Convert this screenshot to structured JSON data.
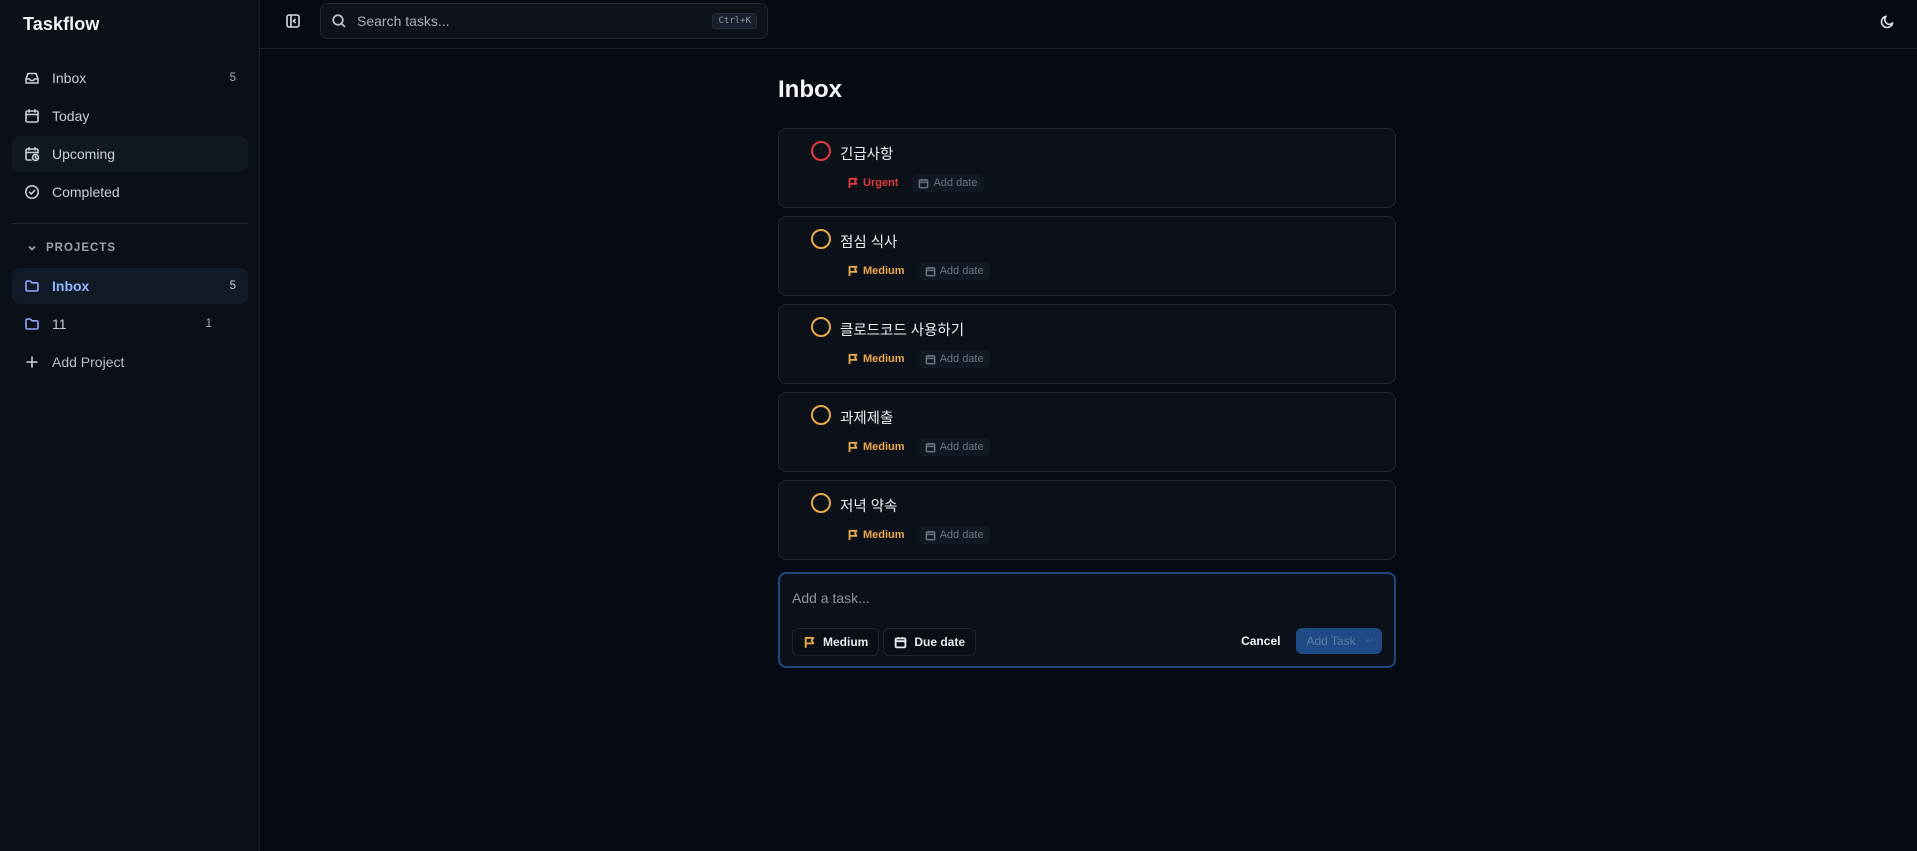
{
  "app": {
    "brand": "Taskflow"
  },
  "sidebar": {
    "nav": [
      {
        "label": "Inbox",
        "count": "5",
        "icon": "inbox-icon"
      },
      {
        "label": "Today",
        "count": "",
        "icon": "calendar-icon"
      },
      {
        "label": "Upcoming",
        "count": "",
        "icon": "calendar-clock-icon"
      },
      {
        "label": "Completed",
        "count": "",
        "icon": "check-circle-icon"
      }
    ],
    "projects_heading": "PROJECTS",
    "projects": [
      {
        "label": "Inbox",
        "count": "5",
        "active": true
      },
      {
        "label": "11",
        "count": "1",
        "active": false
      }
    ],
    "add_project": "Add Project"
  },
  "topbar": {
    "search_placeholder": "Search tasks...",
    "shortcut": "Ctrl+K"
  },
  "main": {
    "title": "Inbox",
    "tasks": [
      {
        "title": "긴급사항",
        "priority": "Urgent",
        "date": "Add date",
        "priority_color": "#e23b3b"
      },
      {
        "title": "점심 식사",
        "priority": "Medium",
        "date": "Add date",
        "priority_color": "#e8a94a"
      },
      {
        "title": "클로드코드 사용하기",
        "priority": "Medium",
        "date": "Add date",
        "priority_color": "#e8a94a"
      },
      {
        "title": "과제제출",
        "priority": "Medium",
        "date": "Add date",
        "priority_color": "#e8a94a"
      },
      {
        "title": "저녁 약속",
        "priority": "Medium",
        "date": "Add date",
        "priority_color": "#e8a94a"
      }
    ],
    "composer": {
      "placeholder": "Add a task...",
      "priority_label": "Medium",
      "due_label": "Due date",
      "cancel_label": "Cancel",
      "add_label": "Add Task"
    }
  },
  "colors": {
    "accent": "#7aa5ff",
    "urgent": "#e23b3b",
    "medium": "#e8a94a",
    "background": "#060a12"
  }
}
